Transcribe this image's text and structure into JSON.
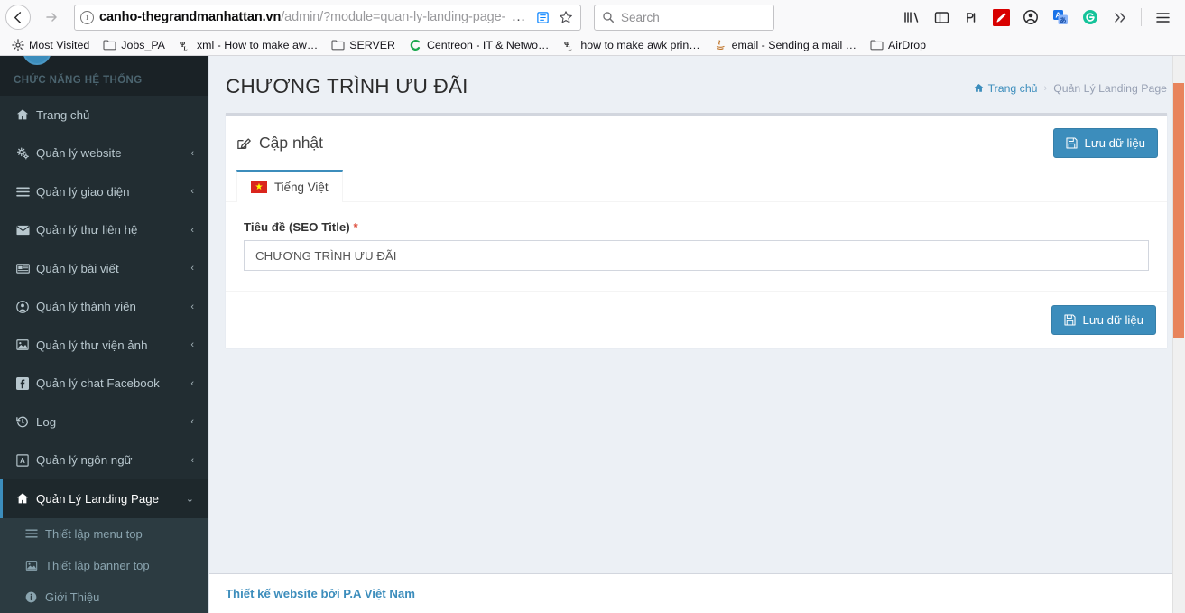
{
  "browser": {
    "back_label": "Back",
    "forward_label": "Forward",
    "url_domain": "canho-thegrandmanhattan.vn",
    "url_path": "/admin/?module=quan-ly-landing-page-bds&acti",
    "info_glyph": "i",
    "page_actions_label": "…",
    "reader_label": "reader-view",
    "bookmark_label": "bookmark-star",
    "search_placeholder": "Search",
    "toolbar_icons": [
      {
        "name": "library-icon",
        "glyph": "|||\\"
      },
      {
        "name": "sidebar-icon",
        "glyph": "▯"
      },
      {
        "name": "pocket-icon",
        "glyph": "℞"
      },
      {
        "name": "highlighter-icon",
        "glyph": "✎"
      },
      {
        "name": "account-icon",
        "glyph": "☻"
      },
      {
        "name": "translate-icon",
        "glyph": "A"
      },
      {
        "name": "grammarly-icon",
        "glyph": "G"
      },
      {
        "name": "overflow-chevrons-icon",
        "glyph": "»"
      },
      {
        "name": "hamburger-menu-icon",
        "glyph": "☰"
      }
    ],
    "bookmarks": [
      {
        "label": "Most Visited",
        "icon": "gear-icon"
      },
      {
        "label": "Jobs_PA",
        "icon": "folder-icon"
      },
      {
        "label": "xml - How to make aw…",
        "icon": "stackexchange-icon"
      },
      {
        "label": "SERVER",
        "icon": "folder-icon"
      },
      {
        "label": "Centreon - IT & Netwo…",
        "icon": "centreon-icon"
      },
      {
        "label": "how to make awk prin…",
        "icon": "stackexchange-icon"
      },
      {
        "label": "email - Sending a mail …",
        "icon": "java-icon"
      },
      {
        "label": "AirDrop",
        "icon": "folder-icon"
      }
    ]
  },
  "sidebar": {
    "heading": "CHỨC NĂNG HỆ THỐNG",
    "items": [
      {
        "label": "Trang chủ",
        "icon": "home-icon",
        "arrow": "",
        "active": false
      },
      {
        "label": "Quản lý website",
        "icon": "gears-icon",
        "arrow": "‹",
        "active": false
      },
      {
        "label": "Quản lý giao diện",
        "icon": "bars-icon",
        "arrow": "‹",
        "active": false
      },
      {
        "label": "Quản lý thư liên hệ",
        "icon": "envelope-icon",
        "arrow": "‹",
        "active": false
      },
      {
        "label": "Quản lý bài viết",
        "icon": "newspaper-icon",
        "arrow": "‹",
        "active": false
      },
      {
        "label": "Quản lý thành viên",
        "icon": "user-circle-icon",
        "arrow": "‹",
        "active": false
      },
      {
        "label": "Quản lý thư viện ảnh",
        "icon": "image-icon",
        "arrow": "‹",
        "active": false
      },
      {
        "label": "Quản lý chat Facebook",
        "icon": "facebook-icon",
        "arrow": "‹",
        "active": false
      },
      {
        "label": "Log",
        "icon": "history-icon",
        "arrow": "‹",
        "active": false
      },
      {
        "label": "Quản lý ngôn ngữ",
        "icon": "language-icon",
        "arrow": "‹",
        "active": false
      },
      {
        "label": "Quản Lý Landing Page",
        "icon": "home-icon",
        "arrow": "⌄",
        "active": true
      }
    ],
    "submenu": [
      {
        "label": "Thiết lập menu top",
        "icon": "bars-icon"
      },
      {
        "label": "Thiết lập banner top",
        "icon": "image-icon"
      },
      {
        "label": "Giới Thiệu",
        "icon": "info-circle-icon"
      }
    ]
  },
  "page": {
    "title": "CHƯƠNG TRÌNH ƯU ĐÃI",
    "breadcrumb": {
      "home": "Trang chủ",
      "separator": "›",
      "current": "Quản Lý Landing Page"
    }
  },
  "box": {
    "title": "Cập nhật",
    "save_label": "Lưu dữ liệu",
    "save_label_footer": "Lưu dữ liệu"
  },
  "tabs": [
    {
      "label": "Tiếng Việt",
      "flag": "vietnam-flag",
      "star": "★",
      "active": true
    }
  ],
  "form": {
    "seo_title_label": "Tiêu đề (SEO Title)",
    "required_mark": "*",
    "seo_title_value": "CHƯƠNG TRÌNH ƯU ĐÃI",
    "seo_title_placeholder": "Tiêu đề (SEO Title)"
  },
  "footer": {
    "credit": "Thiết kế website bởi P.A Việt Nam"
  },
  "colors": {
    "accent_blue": "#3c8dbc",
    "sidebar_bg": "#222d32",
    "sidebar_submenu_bg": "#2c3b41",
    "content_bg": "#ecf0f5",
    "required_red": "#dd4b39",
    "scrollbar_thumb": "#e8845c",
    "flag_red": "#da251d",
    "flag_star_yellow": "#ffff00"
  }
}
